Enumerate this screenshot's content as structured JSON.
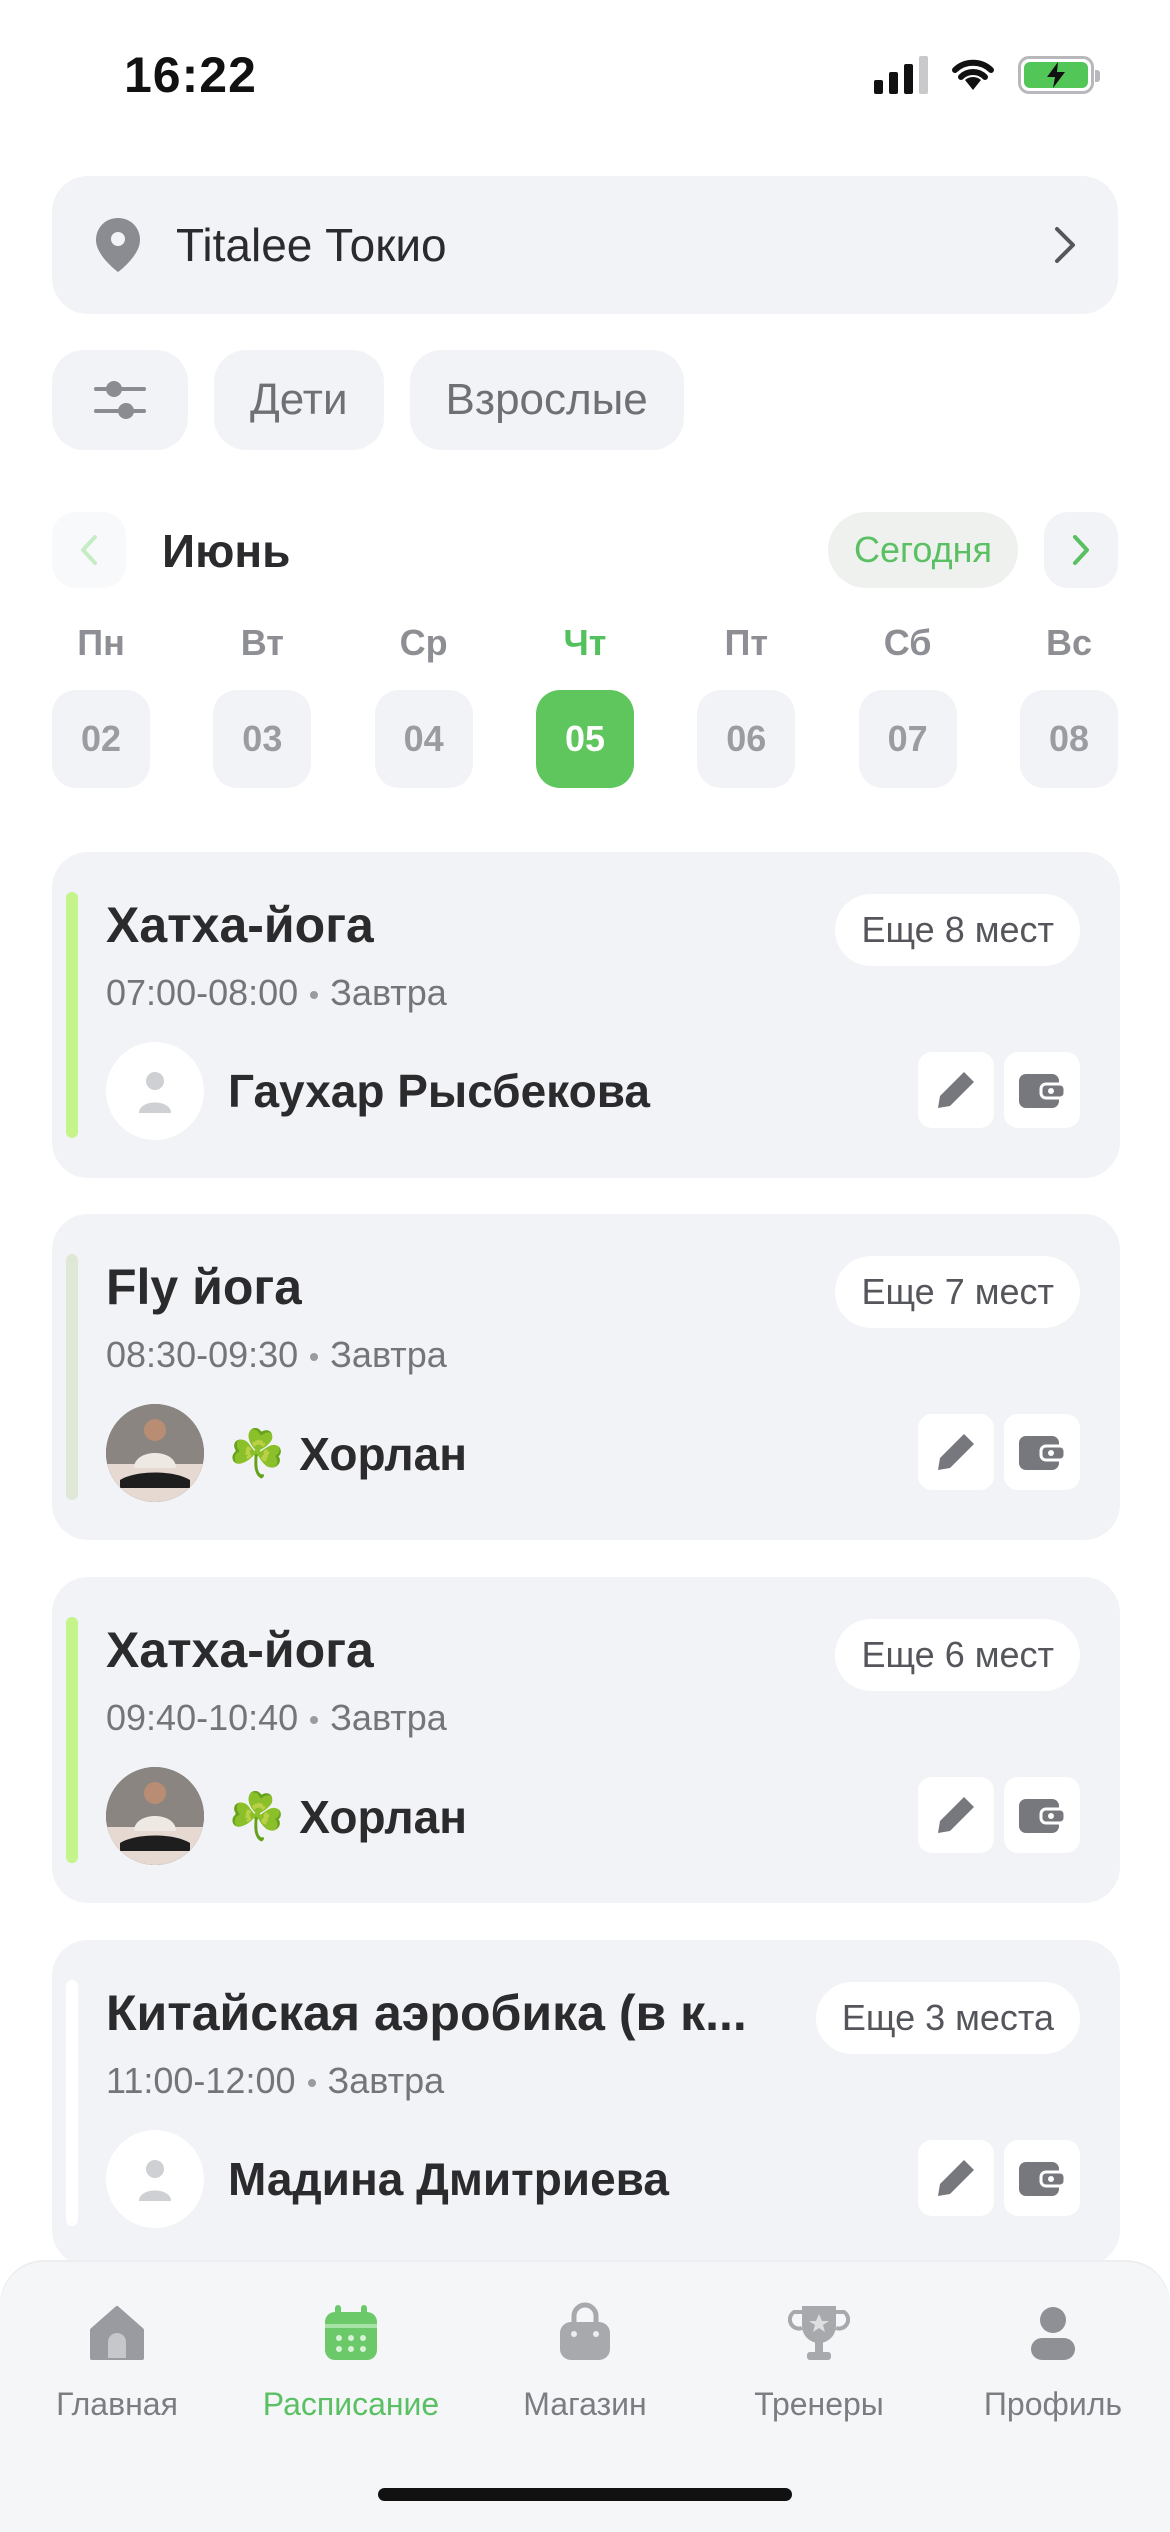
{
  "status_bar": {
    "time": "16:22"
  },
  "location": {
    "name": "Titalee Токио"
  },
  "filters": {
    "items": [
      "Дети",
      "Взрослые"
    ]
  },
  "calendar": {
    "month": "Июнь",
    "today_label": "Сегодня",
    "weekdays": [
      "Пн",
      "Вт",
      "Ср",
      "Чт",
      "Пт",
      "Сб",
      "Вс"
    ],
    "days": [
      "02",
      "03",
      "04",
      "05",
      "06",
      "07",
      "08"
    ],
    "selected_index": 3
  },
  "classes": [
    {
      "title": "Хатха-йога",
      "time": "07:00-08:00",
      "when": "Завтра",
      "spots": "Еще 8 мест",
      "trainer": "Гаухар Рысбекова",
      "trainer_emoji": "",
      "stripe_color": "#c4f48a"
    },
    {
      "title": "Fly йога",
      "time": "08:30-09:30",
      "when": "Завтра",
      "spots": "Еще 7 мест",
      "trainer": "Хорлан",
      "trainer_emoji": "☘️",
      "stripe_color": "#dfe8d6"
    },
    {
      "title": "Хатха-йога",
      "time": "09:40-10:40",
      "when": "Завтра",
      "spots": "Еще 6 мест",
      "trainer": "Хорлан",
      "trainer_emoji": "☘️",
      "stripe_color": "#c4f48a"
    },
    {
      "title": "Китайская аэробика (в к...",
      "time": "11:00-12:00",
      "when": "Завтра",
      "spots": "Еще 3 места",
      "trainer": "Мадина Дмитриева",
      "trainer_emoji": "",
      "stripe_color": "#ffffff"
    }
  ],
  "tabbar": {
    "items": [
      "Главная",
      "Расписание",
      "Магазин",
      "Тренеры",
      "Профиль"
    ],
    "active_index": 1
  },
  "colors": {
    "accent": "#5fc65d",
    "card_bg": "#f2f3f6",
    "text": "#2b2b2e"
  }
}
